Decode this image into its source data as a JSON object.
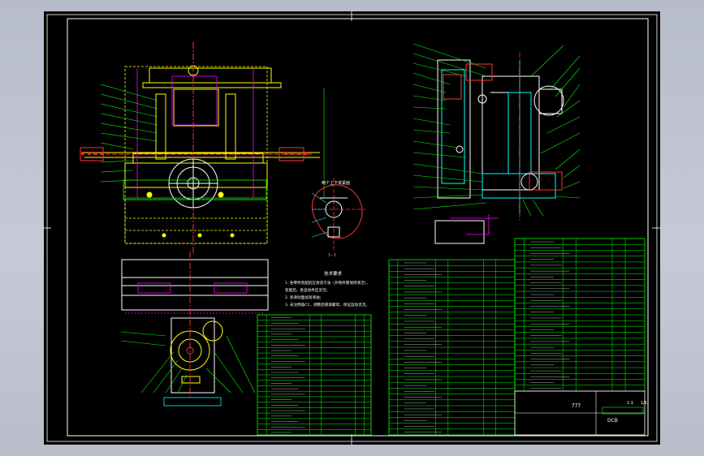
{
  "sheet": {
    "background": "#000000",
    "frame_color": "#ffffff",
    "table_color": "#00ff00",
    "part_color": "#ffff00",
    "section_color": "#00ffff",
    "detail_color": "#ff00ff",
    "accent_color": "#ff3333"
  },
  "detail_view": {
    "title": "两个上下夹紧面",
    "scale_label": "I - I"
  },
  "technical_notes": {
    "title": "技术要求",
    "lines": [
      "1. 各零件装配前应清洗干净（外购件需保持清洁），",
      "装配后，各运动件应灵活；",
      "2. 各滑动面加润滑油；",
      "3. 未注倒角C1，调整后锁紧螺母，保证运动灵活。"
    ]
  },
  "title_block": {
    "drawing_title": "???",
    "drawing_number": "DCB",
    "scale": "1:1",
    "sheet": "1/1"
  }
}
